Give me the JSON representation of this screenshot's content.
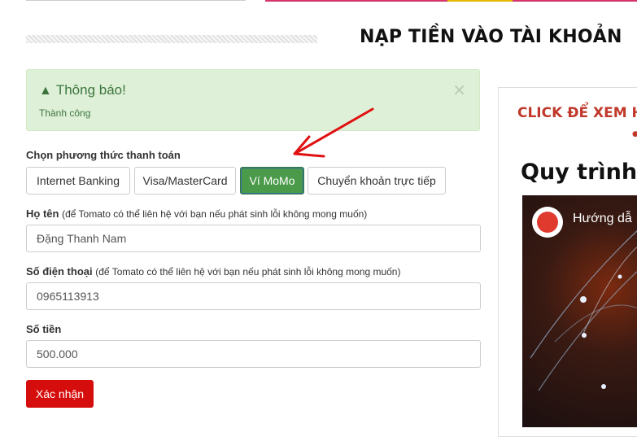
{
  "page": {
    "title": "NẠP TIỀN VÀO TÀI KHOẢN"
  },
  "alert": {
    "title": "Thông báo!",
    "message": "Thành công",
    "close": "×"
  },
  "payment": {
    "label": "Chọn phương thức thanh toán",
    "methods": [
      {
        "label": "Internet Banking",
        "active": false
      },
      {
        "label": "Visa/MasterCard",
        "active": false
      },
      {
        "label": "Ví MoMo",
        "active": true
      },
      {
        "label": "Chuyển khoản trực tiếp",
        "active": false
      }
    ]
  },
  "form": {
    "name_label": "Họ tên",
    "name_hint": "(để Tomato có thể liên hệ với bạn nếu phát sinh lỗi không mong muốn)",
    "name_value": "Đặng Thanh Nam",
    "phone_label": "Số điện thoại",
    "phone_hint": "(để Tomato có thể liên hệ với bạn nếu phát sinh lỗi không mong muốn)",
    "phone_value": "0965113913",
    "amount_label": "Số tiền",
    "amount_value": "500.000",
    "submit_label": "Xác nhận"
  },
  "sidebar": {
    "click_text": "CLICK ĐỂ XEM H",
    "heading": "Quy trình",
    "video_title": "Hướng dẫ"
  },
  "colors": {
    "accent_red": "#d60d0d",
    "momo_active": "#4a9a4a",
    "alert_bg": "#dff0d8",
    "click_text": "#c0392b"
  }
}
